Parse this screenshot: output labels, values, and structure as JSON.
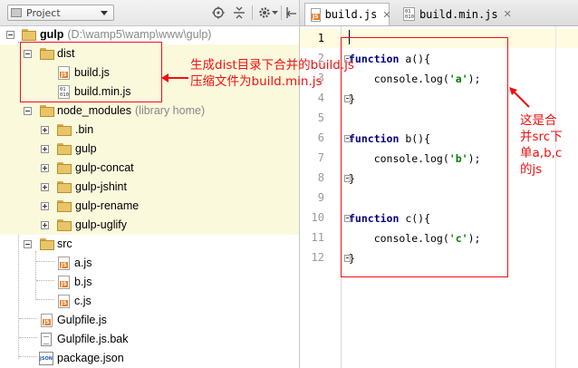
{
  "project_panel": {
    "view_selector": "Project",
    "toolbar_icons": [
      "crosshair-icon",
      "collapse-all-icon",
      "gear-icon",
      "hide-panel-icon"
    ]
  },
  "tree": [
    {
      "label": "gulp",
      "hint": "(D:\\wamp5\\wamp\\www\\gulp)",
      "type": "folder"
    },
    {
      "label": "dist",
      "type": "folder"
    },
    {
      "label": "build.js",
      "type": "js"
    },
    {
      "label": "build.min.js",
      "type": "bin"
    },
    {
      "label": "node_modules",
      "hint": "(library home)",
      "type": "folder"
    },
    {
      "label": ".bin",
      "type": "folder"
    },
    {
      "label": "gulp",
      "type": "folder"
    },
    {
      "label": "gulp-concat",
      "type": "folder"
    },
    {
      "label": "gulp-jshint",
      "type": "folder"
    },
    {
      "label": "gulp-rename",
      "type": "folder"
    },
    {
      "label": "gulp-uglify",
      "type": "folder"
    },
    {
      "label": "src",
      "type": "folder"
    },
    {
      "label": "a.js",
      "type": "js"
    },
    {
      "label": "b.js",
      "type": "js"
    },
    {
      "label": "c.js",
      "type": "js"
    },
    {
      "label": "Gulpfile.js",
      "type": "js"
    },
    {
      "label": "Gulpfile.js.bak",
      "type": "file"
    },
    {
      "label": "package.json",
      "type": "json"
    }
  ],
  "editor": {
    "tabs": [
      {
        "label": "build.js",
        "active": true
      },
      {
        "label": "build.min.js",
        "active": false
      }
    ],
    "line_numbers": [
      "1",
      "2",
      "3",
      "4",
      "5",
      "6",
      "7",
      "8",
      "9",
      "10",
      "11",
      "12"
    ],
    "code": {
      "l2": {
        "kw": "function",
        "rest": " a(){"
      },
      "l3": {
        "pre": "    console.log(",
        "str": "'a'",
        "post": ");"
      },
      "l4": "}",
      "l6": {
        "kw": "function",
        "rest": " b(){"
      },
      "l7": {
        "pre": "    console.log(",
        "str": "'b'",
        "post": ");"
      },
      "l8": "}",
      "l10": {
        "kw": "function",
        "rest": " c(){"
      },
      "l11": {
        "pre": "    console.log(",
        "str": "'c'",
        "post": ");"
      },
      "l12": "}"
    }
  },
  "annotations": {
    "left_note_line1": "生成dist目录下合并的build.js",
    "left_note_line2": "压缩文件为build.min.js",
    "right_note": [
      "这是合",
      "并src下",
      "单a,b,c",
      "的js"
    ],
    "color": "#ee1111"
  },
  "colors": {
    "keyword": "#000080",
    "string": "#008000",
    "folder": "#e9c468",
    "highlight_row": "#fbf9dc"
  }
}
